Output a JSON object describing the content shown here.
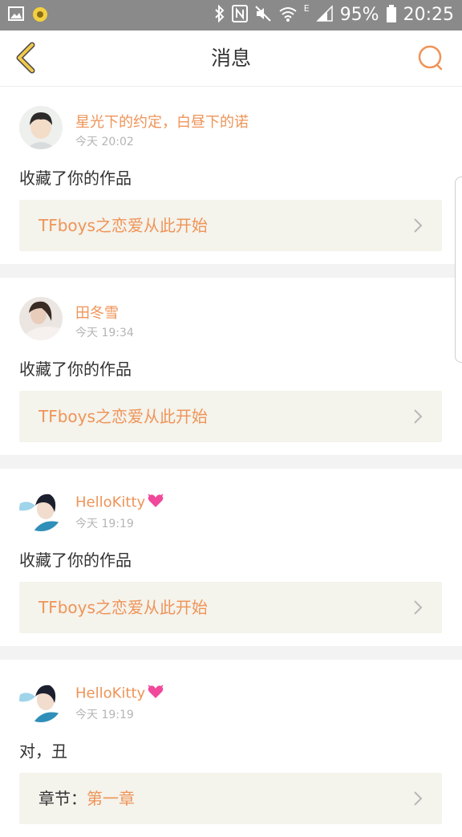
{
  "status_bar": {
    "battery": "95%",
    "time": "20:25",
    "network_label": "E",
    "icons": [
      "gallery-icon",
      "notification-icon",
      "bluetooth-icon",
      "nfc-icon",
      "mute-icon",
      "wifi-icon",
      "signal-icon",
      "battery-icon"
    ]
  },
  "nav": {
    "title": "消息",
    "back_icon": "chevron-left-icon",
    "search_icon": "search-icon"
  },
  "colors": {
    "accent": "#ef9458",
    "nav_icon": "#f2c94c",
    "card_box": "#f4f3ec",
    "status_bar": "#8a8a8a"
  },
  "messages": [
    {
      "user": "星光下的约定，白昼下的诺",
      "time": "今天 20:02",
      "action": "收藏了你的作品",
      "link": "TFboys之恋爱从此开始",
      "avatar_style": "boy-portrait",
      "heart": false
    },
    {
      "user": "田冬雪",
      "time": "今天 19:34",
      "action": "收藏了你的作品",
      "link": "TFboys之恋爱从此开始",
      "avatar_style": "girl-portrait",
      "heart": false
    },
    {
      "user": "HelloKitty",
      "time": "今天 19:19",
      "action": "收藏了你的作品",
      "link": "TFboys之恋爱从此开始",
      "avatar_style": "boy-side",
      "heart": true
    },
    {
      "user": "HelloKitty",
      "time": "今天 19:19",
      "action": "对，丑",
      "link_prefix": "章节：",
      "link": "第一章",
      "avatar_style": "boy-side",
      "heart": true
    }
  ]
}
